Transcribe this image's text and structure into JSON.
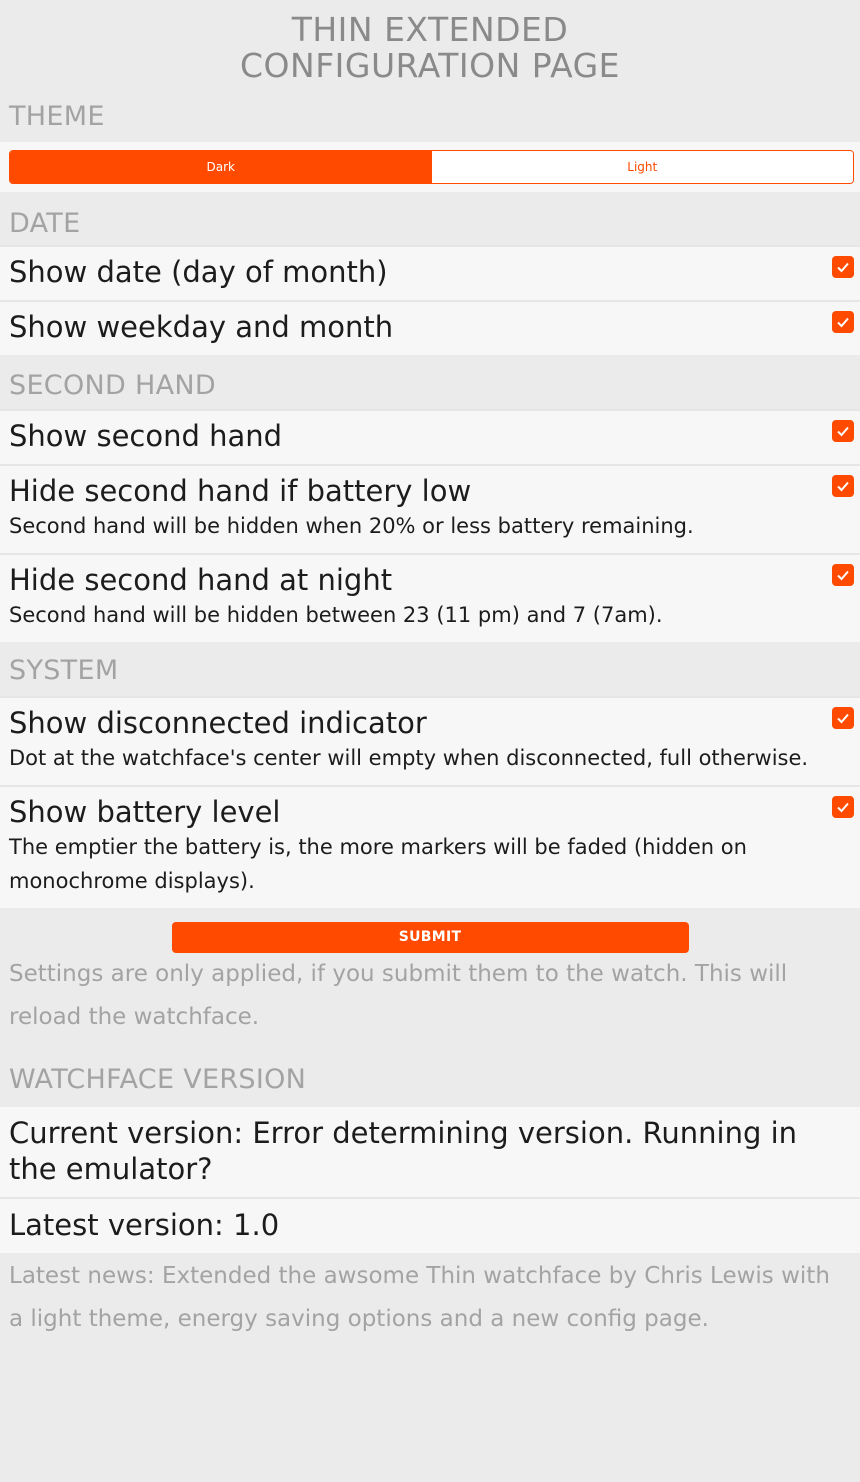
{
  "title": {
    "line1": "THIN EXTENDED",
    "line2": "CONFIGURATION PAGE"
  },
  "theme": {
    "heading": "THEME",
    "options": [
      "Dark",
      "Light"
    ],
    "selected": "Dark"
  },
  "date": {
    "heading": "DATE",
    "items": [
      {
        "label": "Show date (day of month)",
        "checked": true
      },
      {
        "label": "Show weekday and month",
        "checked": true
      }
    ]
  },
  "second_hand": {
    "heading": "SECOND HAND",
    "items": [
      {
        "label": "Show second hand",
        "checked": true
      },
      {
        "label": "Hide second hand if battery low",
        "description": "Second hand will be hidden when 20% or less battery remaining.",
        "checked": true
      },
      {
        "label": "Hide second hand at night",
        "description": "Second hand will be hidden between 23 (11 pm) and 7 (7am).",
        "checked": true
      }
    ]
  },
  "system": {
    "heading": "SYSTEM",
    "items": [
      {
        "label": "Show disconnected indicator",
        "description": "Dot at the watchface's center will empty when disconnected, full otherwise.",
        "checked": true
      },
      {
        "label": "Show battery level",
        "description": "The emptier the battery is, the more markers will be faded (hidden on monochrome displays).",
        "checked": true
      }
    ]
  },
  "submit": {
    "label": "SUBMIT",
    "note": "Settings are only applied, if you submit them to the watch. This will reload the watchface."
  },
  "version": {
    "heading": "WATCHFACE VERSION",
    "current": "Current version: Error determining version. Running in the emulator?",
    "latest": "Latest version: 1.0",
    "news": "Latest news: Extended the awsome Thin watchface by Chris Lewis with a light theme, energy saving options and a new config page."
  },
  "colors": {
    "accent": "#ff4a00",
    "background": "#ebebeb",
    "row": "#f7f7f7",
    "heading": "#a3a3a3"
  }
}
